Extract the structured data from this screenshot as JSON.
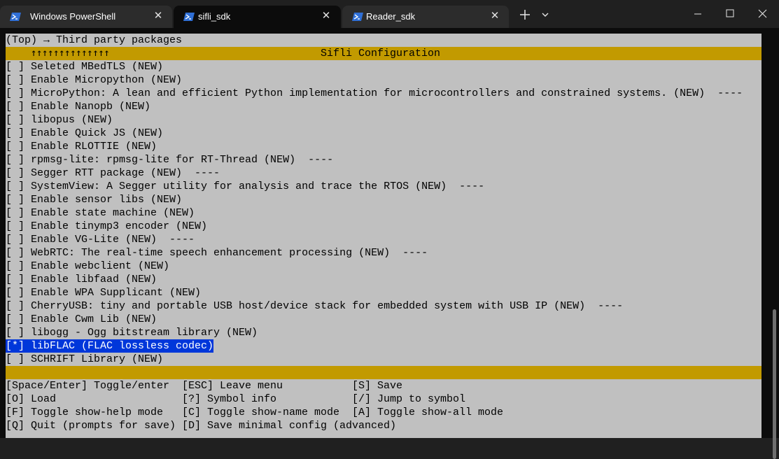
{
  "tabs": [
    {
      "label": "Windows PowerShell",
      "icon": "powershell-icon",
      "active": false
    },
    {
      "label": "sifli_sdk",
      "icon": "powershell-icon",
      "active": true
    },
    {
      "label": "Reader_sdk",
      "icon": "powershell-icon",
      "active": false
    }
  ],
  "terminal": {
    "breadcrumb": "(Top) → Third party packages",
    "scroll_arrows": "↑↑↑↑↑↑↑↑↑↑↑↑↑↑",
    "menu_title": "Sifli Configuration",
    "items": [
      "[ ] Seleted MBedTLS (NEW)",
      "[ ] Enable Micropython (NEW)",
      "[ ] MicroPython: A lean and efficient Python implementation for microcontrollers and constrained systems. (NEW)  ----",
      "[ ] Enable Nanopb (NEW)",
      "[ ] libopus (NEW)",
      "[ ] Enable Quick JS (NEW)",
      "[ ] Enable RLOTTIE (NEW)",
      "[ ] rpmsg-lite: rpmsg-lite for RT-Thread (NEW)  ----",
      "[ ] Segger RTT package (NEW)  ----",
      "[ ] SystemView: A Segger utility for analysis and trace the RTOS (NEW)  ----",
      "[ ] Enable sensor libs (NEW)",
      "[ ] Enable state machine (NEW)",
      "[ ] Enable tinymp3 encoder (NEW)",
      "[ ] Enable VG-Lite (NEW)  ----",
      "[ ] WebRTC: The real-time speech enhancement processing (NEW)  ----",
      "[ ] Enable webclient (NEW)",
      "[ ] Enable libfaad (NEW)",
      "[ ] Enable WPA Supplicant (NEW)",
      "[ ] CherryUSB: tiny and portable USB host/device stack for embedded system with USB IP (NEW)  ----",
      "[ ] Enable Cwm Lib (NEW)",
      "[ ] libogg - Ogg bitstream library (NEW)",
      "[*] libFLAC (FLAC lossless codec)",
      "[ ] SCHRIFT Library (NEW)"
    ],
    "selected_index": 21,
    "help_rows": [
      [
        "[Space/Enter] Toggle/enter",
        "[ESC] Leave menu",
        "[S] Save"
      ],
      [
        "[O] Load",
        "[?] Symbol info",
        "[/] Jump to symbol"
      ],
      [
        "[F] Toggle show-help mode",
        "[C] Toggle show-name mode",
        "[A] Toggle show-all mode"
      ],
      [
        "[Q] Quit (prompts for save)",
        "[D] Save minimal config (advanced)",
        ""
      ]
    ]
  },
  "colors": {
    "terminal_bg": "#c0c0c0",
    "title_bar": "#c29a00",
    "selection": "#0037da",
    "window_bg": "#0c0c0c"
  }
}
